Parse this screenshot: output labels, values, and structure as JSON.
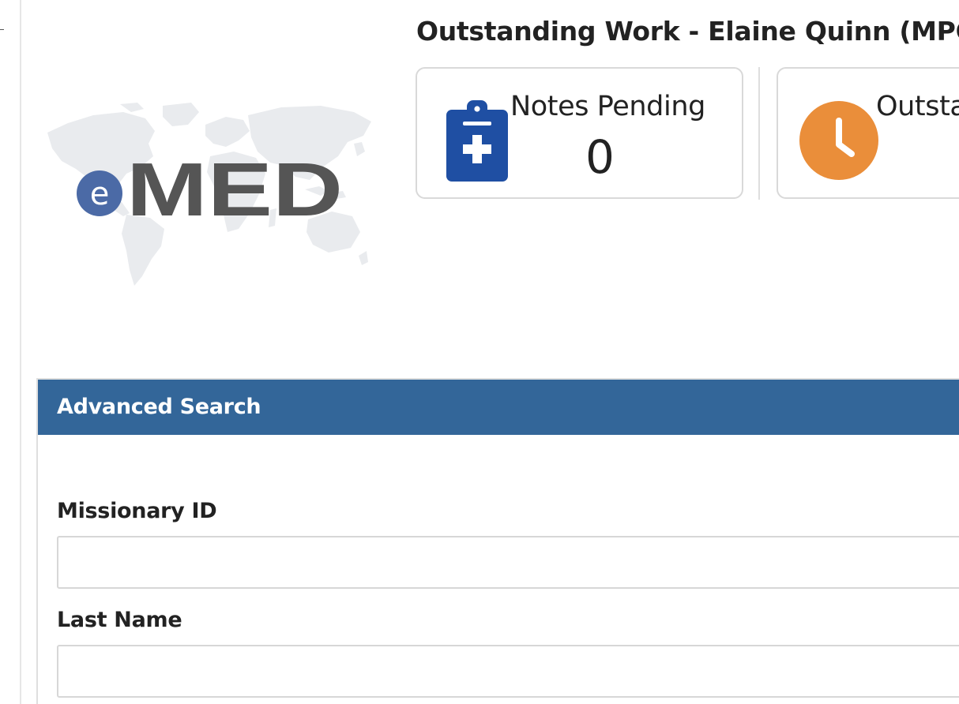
{
  "logo": {
    "text_prefix": "e",
    "text_main": "MED",
    "prefix_color": "#4b6aa6",
    "main_color": "#555555",
    "map_color": "#e9ebee"
  },
  "outstanding_work": {
    "title": "Outstanding Work - Elaine Quinn (MPC)",
    "cards": [
      {
        "label": "Notes Pending",
        "count": "0",
        "icon": "clipboard-plus-icon",
        "icon_color": "#1f4fa3"
      },
      {
        "label": "Outsta",
        "icon": "clock-icon",
        "icon_color": "#ea8e3a"
      }
    ]
  },
  "advanced_search": {
    "header": "Advanced Search",
    "header_color": "#336699",
    "fields": [
      {
        "label": "Missionary ID",
        "value": "",
        "placeholder": ""
      },
      {
        "label": "Last Name",
        "value": "",
        "placeholder": ""
      }
    ]
  }
}
